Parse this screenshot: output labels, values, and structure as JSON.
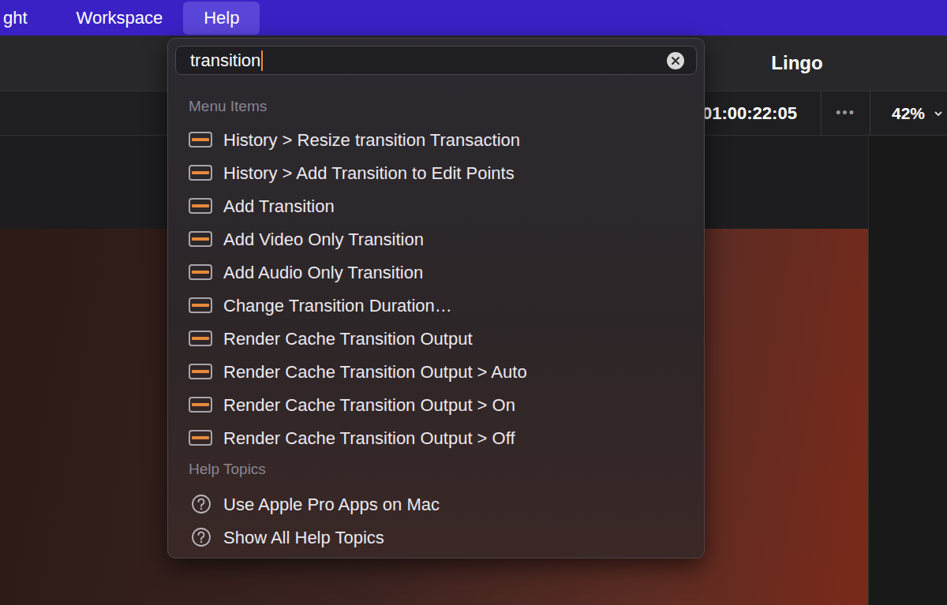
{
  "menu_bar": {
    "items": [
      {
        "label": "ght",
        "selected": false
      },
      {
        "label": "Workspace",
        "selected": false
      },
      {
        "label": "Help",
        "selected": true
      }
    ]
  },
  "project_title": "Lingo",
  "toolbar": {
    "timecode": "01:00:22:05",
    "more": "•••",
    "zoom": "42%"
  },
  "help_menu": {
    "search": {
      "value": "transition"
    },
    "sections": [
      {
        "title": "Menu Items",
        "kind": "menu",
        "items": [
          "History > Resize transition Transaction",
          "History > Add Transition to Edit Points",
          "Add Transition",
          "Add Video Only Transition",
          "Add Audio Only Transition",
          "Change Transition Duration…",
          "Render Cache Transition Output",
          "Render Cache Transition Output > Auto",
          "Render Cache Transition Output > On",
          "Render Cache Transition Output > Off"
        ]
      },
      {
        "title": "Help Topics",
        "kind": "help",
        "items": [
          "Use Apple Pro Apps on Mac",
          "Show All Help Topics"
        ]
      }
    ]
  }
}
